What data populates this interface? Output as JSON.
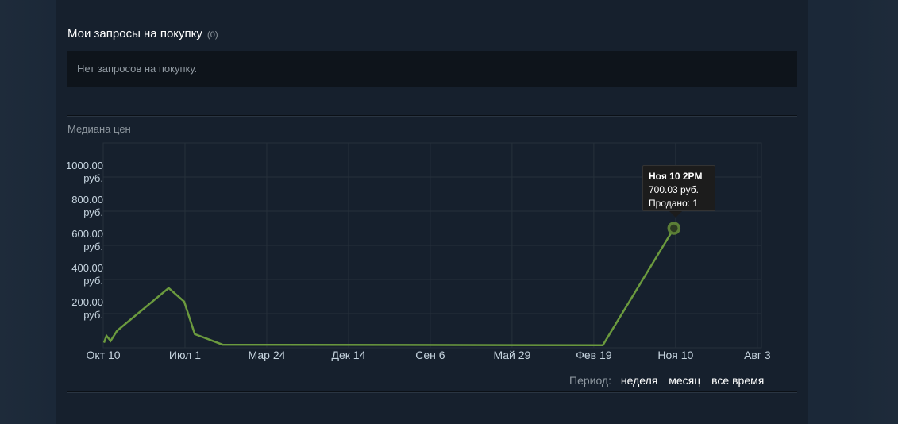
{
  "buy_requests": {
    "title": "Мои запросы на покупку",
    "count": "(0)",
    "empty_text": "Нет запросов на покупку."
  },
  "price_history": {
    "title": "Медиана цен",
    "tooltip": {
      "date": "Ноя 10 2PM",
      "price": "700.03 руб.",
      "sold": "Продано: 1"
    },
    "period": {
      "label": "Период:",
      "options": [
        "неделя",
        "месяц",
        "все время"
      ]
    }
  },
  "chart_data": {
    "type": "line",
    "title": "Медиана цен",
    "x_ticks": [
      "Окт 10",
      "Июл 1",
      "Мар 24",
      "Дек 14",
      "Сен 6",
      "Май 29",
      "Фев 19",
      "Ноя 10",
      "Авг 3"
    ],
    "y_ticks": [
      {
        "value": 200,
        "label": "200.00\nруб."
      },
      {
        "value": 400,
        "label": "400.00\nруб."
      },
      {
        "value": 600,
        "label": "600.00\nруб."
      },
      {
        "value": 800,
        "label": "800.00\nруб."
      },
      {
        "value": 1000,
        "label": "1000.00\nруб."
      }
    ],
    "ylim": [
      0,
      1200
    ],
    "xlim": [
      0,
      8.05
    ],
    "line_color": "#6b9a3e",
    "series": [
      {
        "x": [
          0.01,
          0.04,
          0.09,
          0.17,
          0.8,
          0.99,
          1.12,
          1.46,
          6.11,
          6.98
        ],
        "values": [
          30,
          70,
          40,
          100,
          350,
          270,
          80,
          18,
          15,
          700
        ]
      }
    ],
    "highlight": {
      "x": 6.98,
      "value": 700.03
    },
    "grid": true
  }
}
